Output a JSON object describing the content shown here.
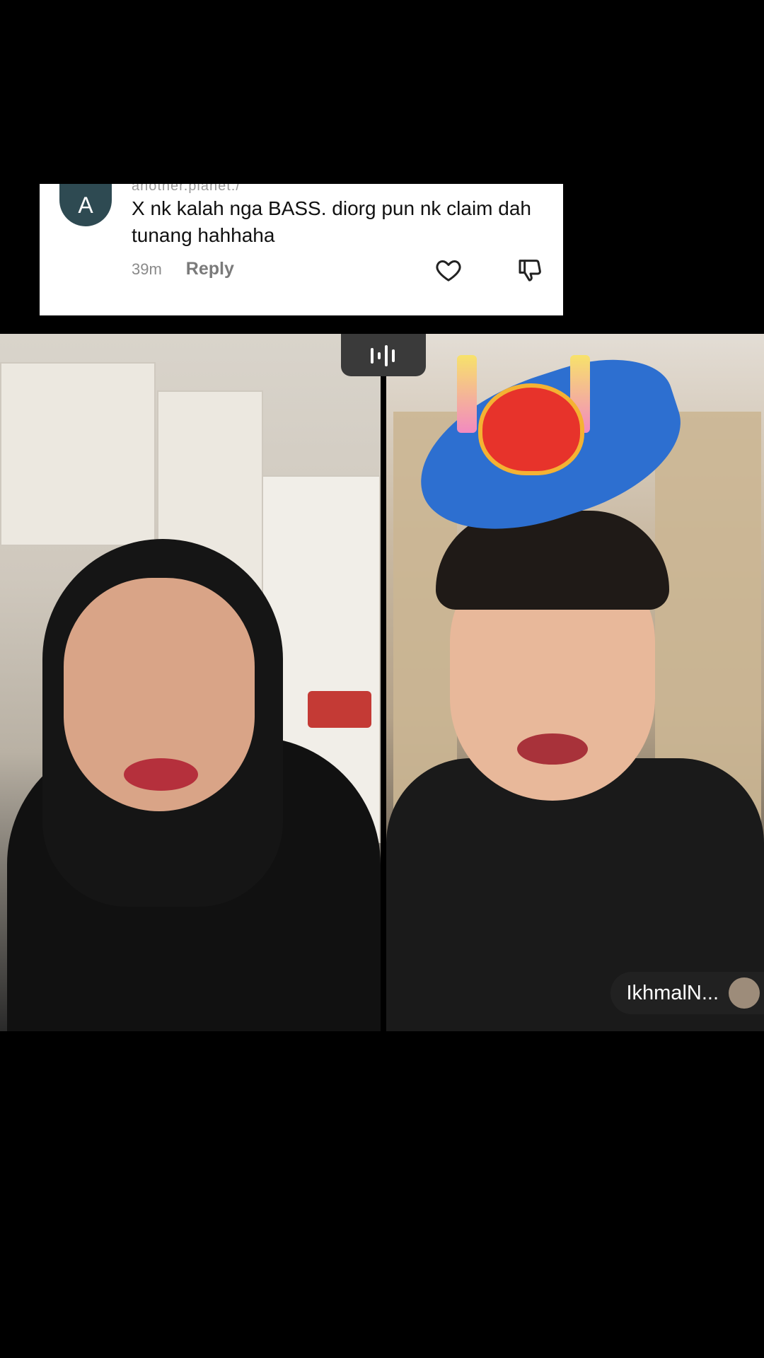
{
  "comment": {
    "avatar_letter": "A",
    "username_partial": "another.planet:/",
    "text": "X nk kalah nga BASS. diorg pun nk claim dah tunang hahhaha",
    "time": "39m",
    "reply_label": "Reply",
    "like_icon": "heart-outline-icon",
    "dislike_icon": "thumbs-down-outline-icon",
    "avatar_color": "#2e4a52"
  },
  "live": {
    "mic_icon": "audio-bars-icon",
    "right_streamer_name": "IkhmalN..."
  }
}
